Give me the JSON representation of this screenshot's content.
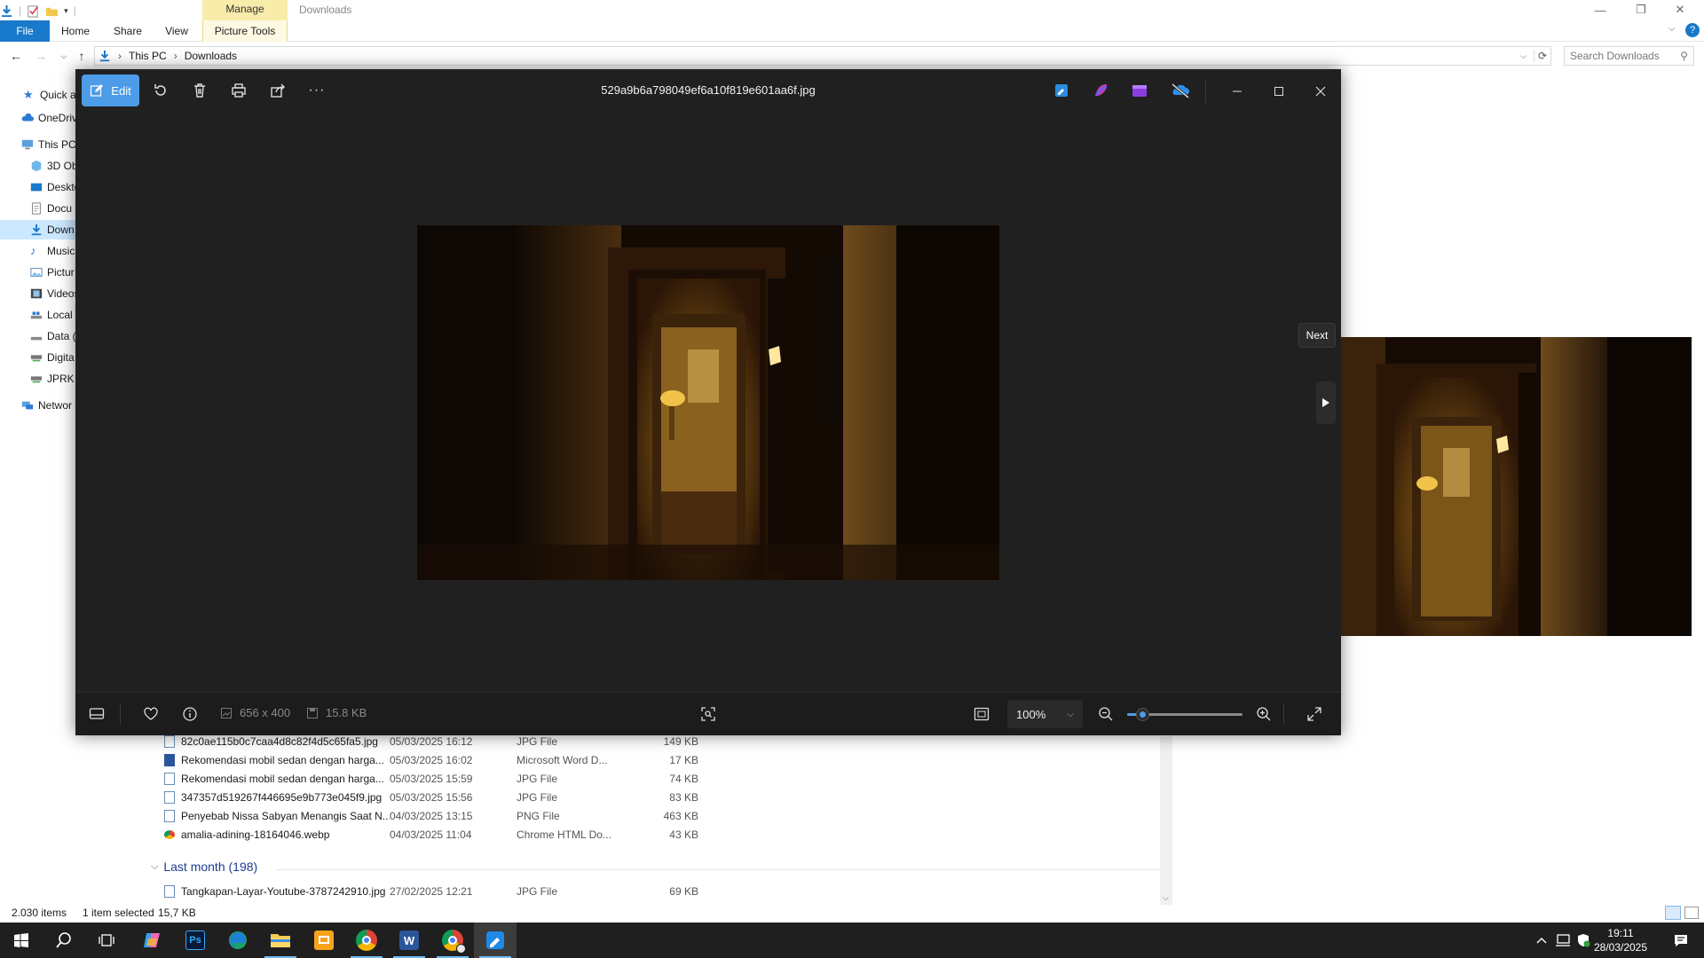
{
  "explorer": {
    "title": "Downloads",
    "context_tab": "Manage",
    "ribbon_tabs": [
      "File",
      "Home",
      "Share",
      "View",
      "Picture Tools"
    ],
    "breadcrumb": [
      "This PC",
      "Downloads"
    ],
    "search_placeholder": "Search Downloads",
    "nav_items": [
      {
        "label": "Quick a",
        "icon": "star-icon"
      },
      {
        "label": "OneDriv",
        "icon": "cloud-icon"
      },
      {
        "label": "This PC",
        "icon": "computer-icon"
      },
      {
        "label": "3D Ob",
        "icon": "cube-icon"
      },
      {
        "label": "Deskto",
        "icon": "desktop-icon"
      },
      {
        "label": "Docu",
        "icon": "document-icon"
      },
      {
        "label": "Down",
        "icon": "download-icon"
      },
      {
        "label": "Music",
        "icon": "music-icon"
      },
      {
        "label": "Pictur",
        "icon": "picture-icon"
      },
      {
        "label": "Videos",
        "icon": "video-icon"
      },
      {
        "label": "Local",
        "icon": "drive-icon"
      },
      {
        "label": "Data (",
        "icon": "drive-icon"
      },
      {
        "label": "Digita",
        "icon": "network-drive-icon"
      },
      {
        "label": "JPRK",
        "icon": "network-drive-icon"
      },
      {
        "label": "Networ",
        "icon": "network-icon"
      }
    ],
    "files": [
      {
        "name": "82c0ae115b0c7caa4d8c82f4d5c65fa5.jpg",
        "date": "05/03/2025 16:12",
        "type": "JPG File",
        "size": "149 KB",
        "icon": "jpg-file-icon"
      },
      {
        "name": "Rekomendasi mobil sedan dengan harga...",
        "date": "05/03/2025 16:02",
        "type": "Microsoft Word D...",
        "size": "17 KB",
        "icon": "word-file-icon"
      },
      {
        "name": "Rekomendasi mobil sedan dengan harga...",
        "date": "05/03/2025 15:59",
        "type": "JPG File",
        "size": "74 KB",
        "icon": "jpg-file-icon"
      },
      {
        "name": "347357d519267f446695e9b773e045f9.jpg",
        "date": "05/03/2025 15:56",
        "type": "JPG File",
        "size": "83 KB",
        "icon": "jpg-file-icon"
      },
      {
        "name": "Penyebab Nissa Sabyan Menangis Saat N...",
        "date": "04/03/2025 13:15",
        "type": "PNG File",
        "size": "463 KB",
        "icon": "png-file-icon"
      },
      {
        "name": "amalia-adining-18164046.webp",
        "date": "04/03/2025 11:04",
        "type": "Chrome HTML Do...",
        "size": "43 KB",
        "icon": "chrome-file-icon"
      }
    ],
    "group_header": "Last month (198)",
    "group_files": [
      {
        "name": "Tangkapan-Layar-Youtube-3787242910.jpg",
        "date": "27/02/2025 12:21",
        "type": "JPG File",
        "size": "69 KB",
        "icon": "jpg-file-icon"
      }
    ],
    "status": {
      "items": "2.030 items",
      "selected": "1 item selected",
      "sel_size": "15,7 KB"
    }
  },
  "viewer": {
    "filename": "529a9b6a798049ef6a10f819e601aa6f.jpg",
    "edit_label": "Edit",
    "dimensions": "656 x 400",
    "file_size": "15.8 KB",
    "zoom": "100%",
    "zoom_level": 0.14,
    "next_tooltip": "Next"
  },
  "taskbar": {
    "apps": [
      "start",
      "search",
      "task-view",
      "copilot",
      "photoshop",
      "edge",
      "file-explorer",
      "slides",
      "chrome",
      "word",
      "chrome-profile",
      "photos"
    ],
    "time": "19:11",
    "date": "28/03/2025"
  },
  "colors": {
    "accent": "#4c9ce8",
    "file_tab": "#1979ca",
    "manage_tab": "#f7ecaa",
    "viewer_bg": "#202020",
    "taskbar": "#1f1f1f"
  }
}
